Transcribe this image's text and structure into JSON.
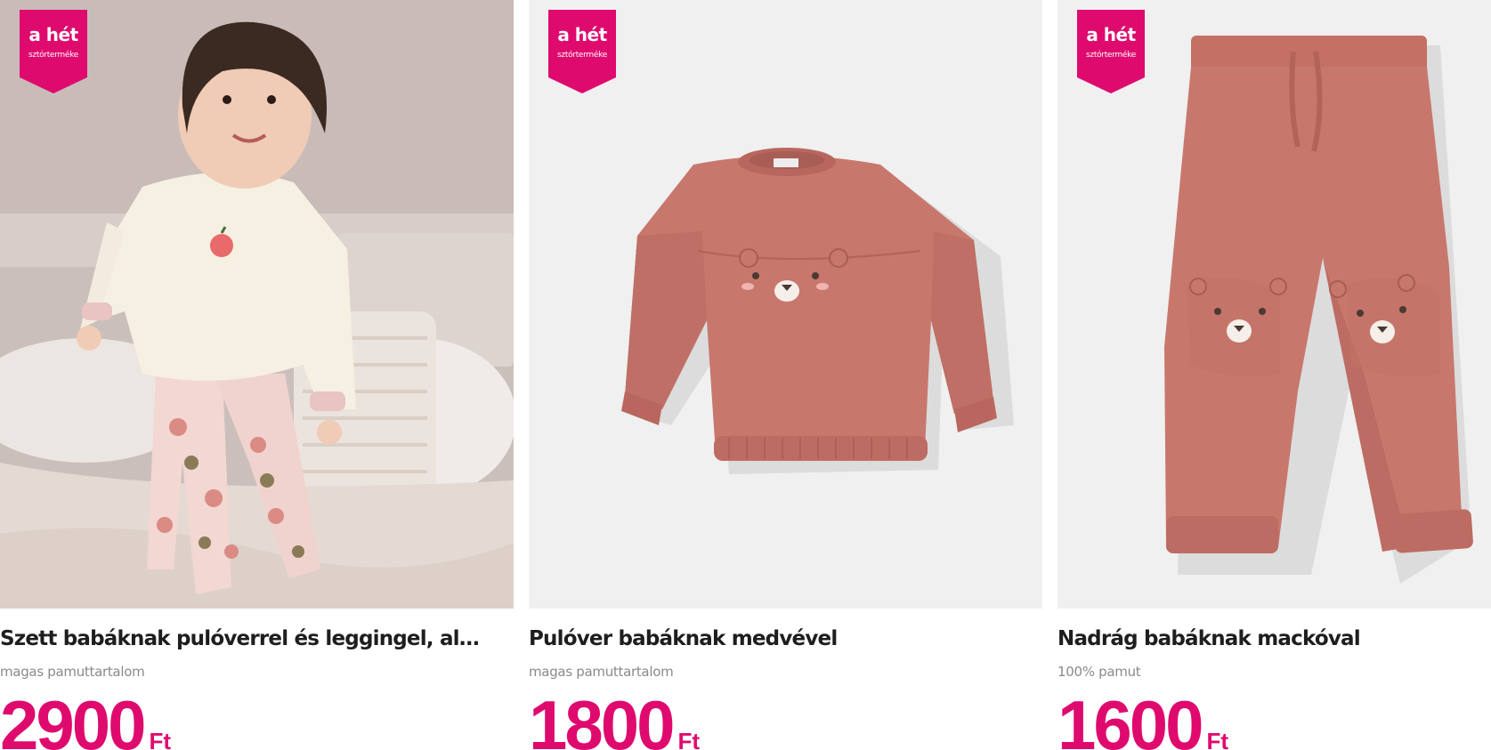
{
  "colors": {
    "accent": "#df0a6e",
    "title_text": "#1e1e1e",
    "subtitle_text": "#8a8a8a"
  },
  "products": [
    {
      "badge_line1": "a hét",
      "badge_line2": "sztórterméke",
      "title": "Szett babáknak pulóverrel és leggingel, alm...",
      "subtitle": "magas pamuttartalom",
      "price": "2900",
      "currency": "Ft",
      "image_alt": "Toddler wearing cream sweater and pink apple-print leggings"
    },
    {
      "badge_line1": "a hét",
      "badge_line2": "sztórterméke",
      "title": "Pulóver babáknak medvével",
      "subtitle": "magas pamuttartalom",
      "price": "1800",
      "currency": "Ft",
      "image_alt": "Pink sweater with bear face"
    },
    {
      "badge_line1": "a hét",
      "badge_line2": "sztórterméke",
      "title": "Nadrág babáknak mackóval",
      "subtitle": "100% pamut",
      "price": "1600",
      "currency": "Ft",
      "image_alt": "Pink jogger pants with bear faces on knees"
    }
  ]
}
